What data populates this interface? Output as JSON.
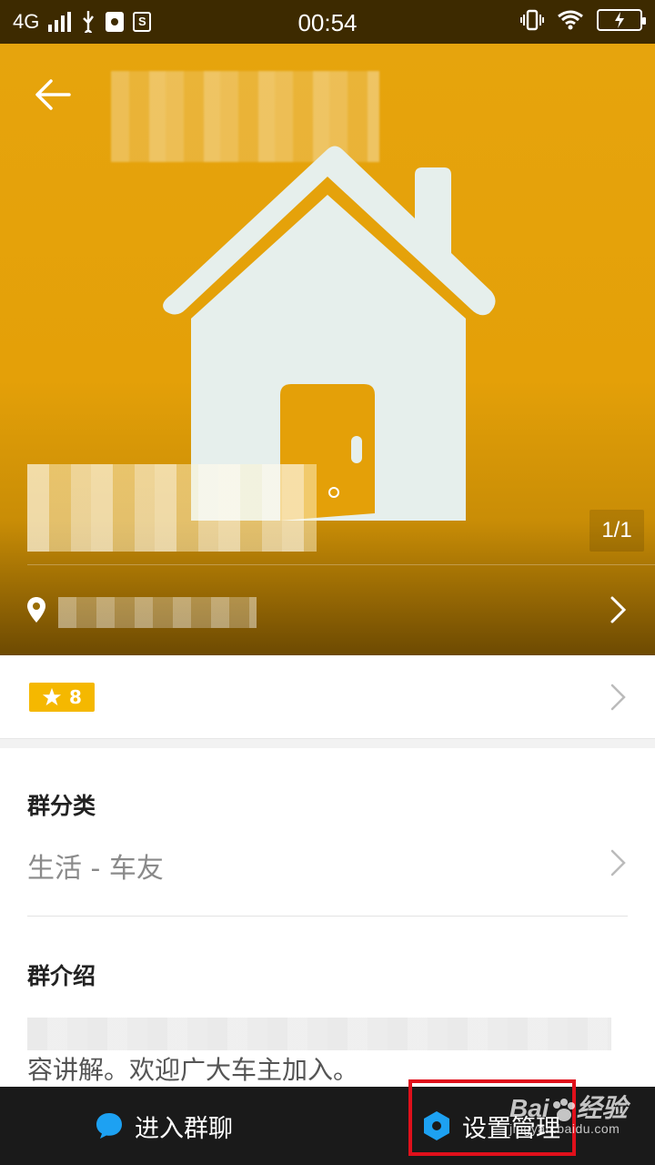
{
  "status_bar": {
    "network": "4G",
    "time": "00:54",
    "s_icon_label": "S"
  },
  "hero": {
    "page_counter": "1/1"
  },
  "rating": {
    "value": "8"
  },
  "category": {
    "label": "群分类",
    "value": "生活 - 车友"
  },
  "intro": {
    "label": "群介绍",
    "text_visible": "容讲解。欢迎广大车主加入。"
  },
  "bottom_bar": {
    "chat_label": "进入群聊",
    "settings_label": "设置管理"
  },
  "watermark": {
    "brand": "Bai",
    "brand2": "经验",
    "url": "jingyan.baidu.com"
  },
  "colors": {
    "hero_orange": "#e6a40d",
    "badge_yellow": "#f5b800",
    "chat_blue": "#1da1f2",
    "highlight_red": "#e0101b",
    "bottom_bar": "#1a1a1a"
  }
}
